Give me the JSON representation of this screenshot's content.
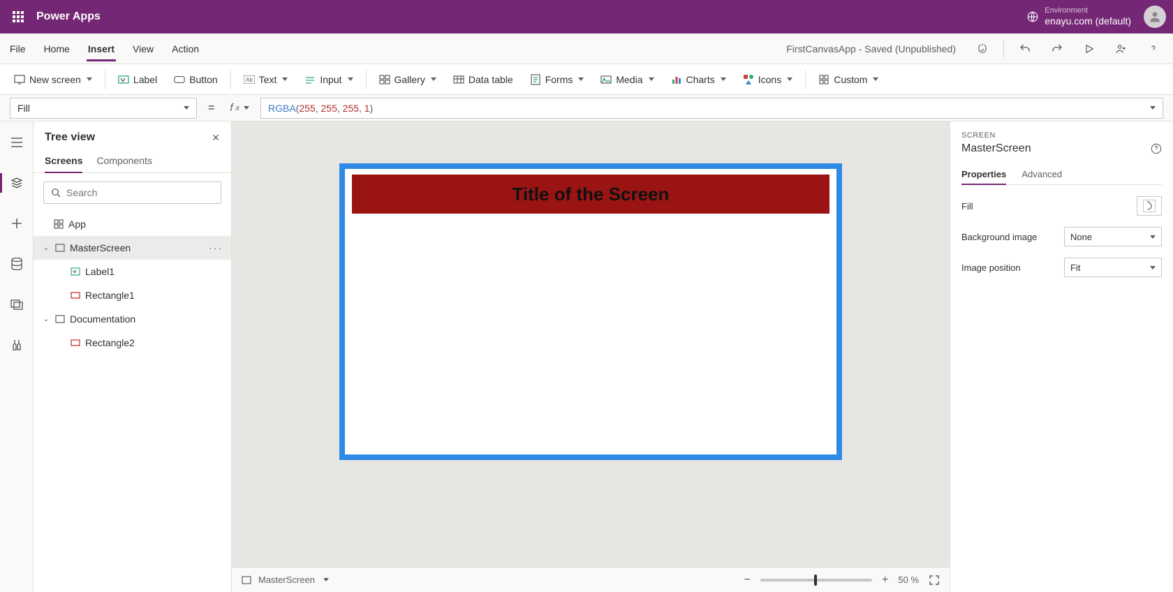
{
  "header": {
    "app_name": "Power Apps",
    "env_label": "Environment",
    "env_name": "enayu.com (default)"
  },
  "menu": {
    "items": [
      "File",
      "Home",
      "Insert",
      "View",
      "Action"
    ],
    "active": "Insert",
    "doc_title": "FirstCanvasApp - Saved (Unpublished)"
  },
  "ribbon": {
    "new_screen": "New screen",
    "label": "Label",
    "button": "Button",
    "text": "Text",
    "input": "Input",
    "gallery": "Gallery",
    "data_table": "Data table",
    "forms": "Forms",
    "media": "Media",
    "charts": "Charts",
    "icons": "Icons",
    "custom": "Custom"
  },
  "formula": {
    "property": "Fill",
    "func": "RGBA",
    "args": [
      "255",
      "255",
      "255",
      "1"
    ]
  },
  "tree": {
    "title": "Tree view",
    "tabs": {
      "screens": "Screens",
      "components": "Components"
    },
    "search_placeholder": "Search",
    "app": "App",
    "items": [
      {
        "name": "MasterScreen",
        "selected": true
      },
      {
        "name": "Label1",
        "indent": 1,
        "icon": "label"
      },
      {
        "name": "Rectangle1",
        "indent": 1,
        "icon": "rect"
      },
      {
        "name": "Documentation",
        "indent": 0,
        "icon": "screen",
        "caret": true
      },
      {
        "name": "Rectangle2",
        "indent": 1,
        "icon": "rect"
      }
    ]
  },
  "canvas": {
    "title_text": "Title of the Screen"
  },
  "status": {
    "screen": "MasterScreen",
    "zoom": "50",
    "zoom_unit": "%"
  },
  "props": {
    "type": "SCREEN",
    "name": "MasterScreen",
    "tabs": {
      "properties": "Properties",
      "advanced": "Advanced"
    },
    "fill_label": "Fill",
    "bg_image_label": "Background image",
    "bg_image_value": "None",
    "img_pos_label": "Image position",
    "img_pos_value": "Fit"
  }
}
